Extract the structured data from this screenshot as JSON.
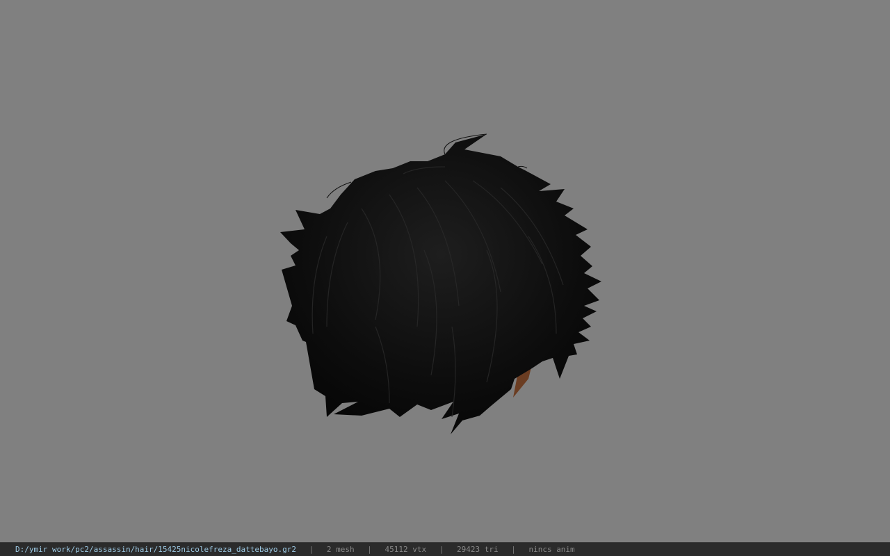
{
  "viewport": {
    "background_color": "#808080",
    "model_color": "#0c0c0c",
    "model_highlight_color": "#262626",
    "accent_strand_color": "#6b3d22"
  },
  "statusbar": {
    "file_path": "D:/ymir work/pc2/assassin/hair/15425nicolefreza_dattebayo.gr2",
    "separator": "|",
    "mesh": "2 mesh",
    "vertices": "45112 vtx",
    "triangles": "29423 tri",
    "animation": "nincs anim",
    "path_color": "#9ecbe6",
    "text_color": "#8a8a8a"
  }
}
